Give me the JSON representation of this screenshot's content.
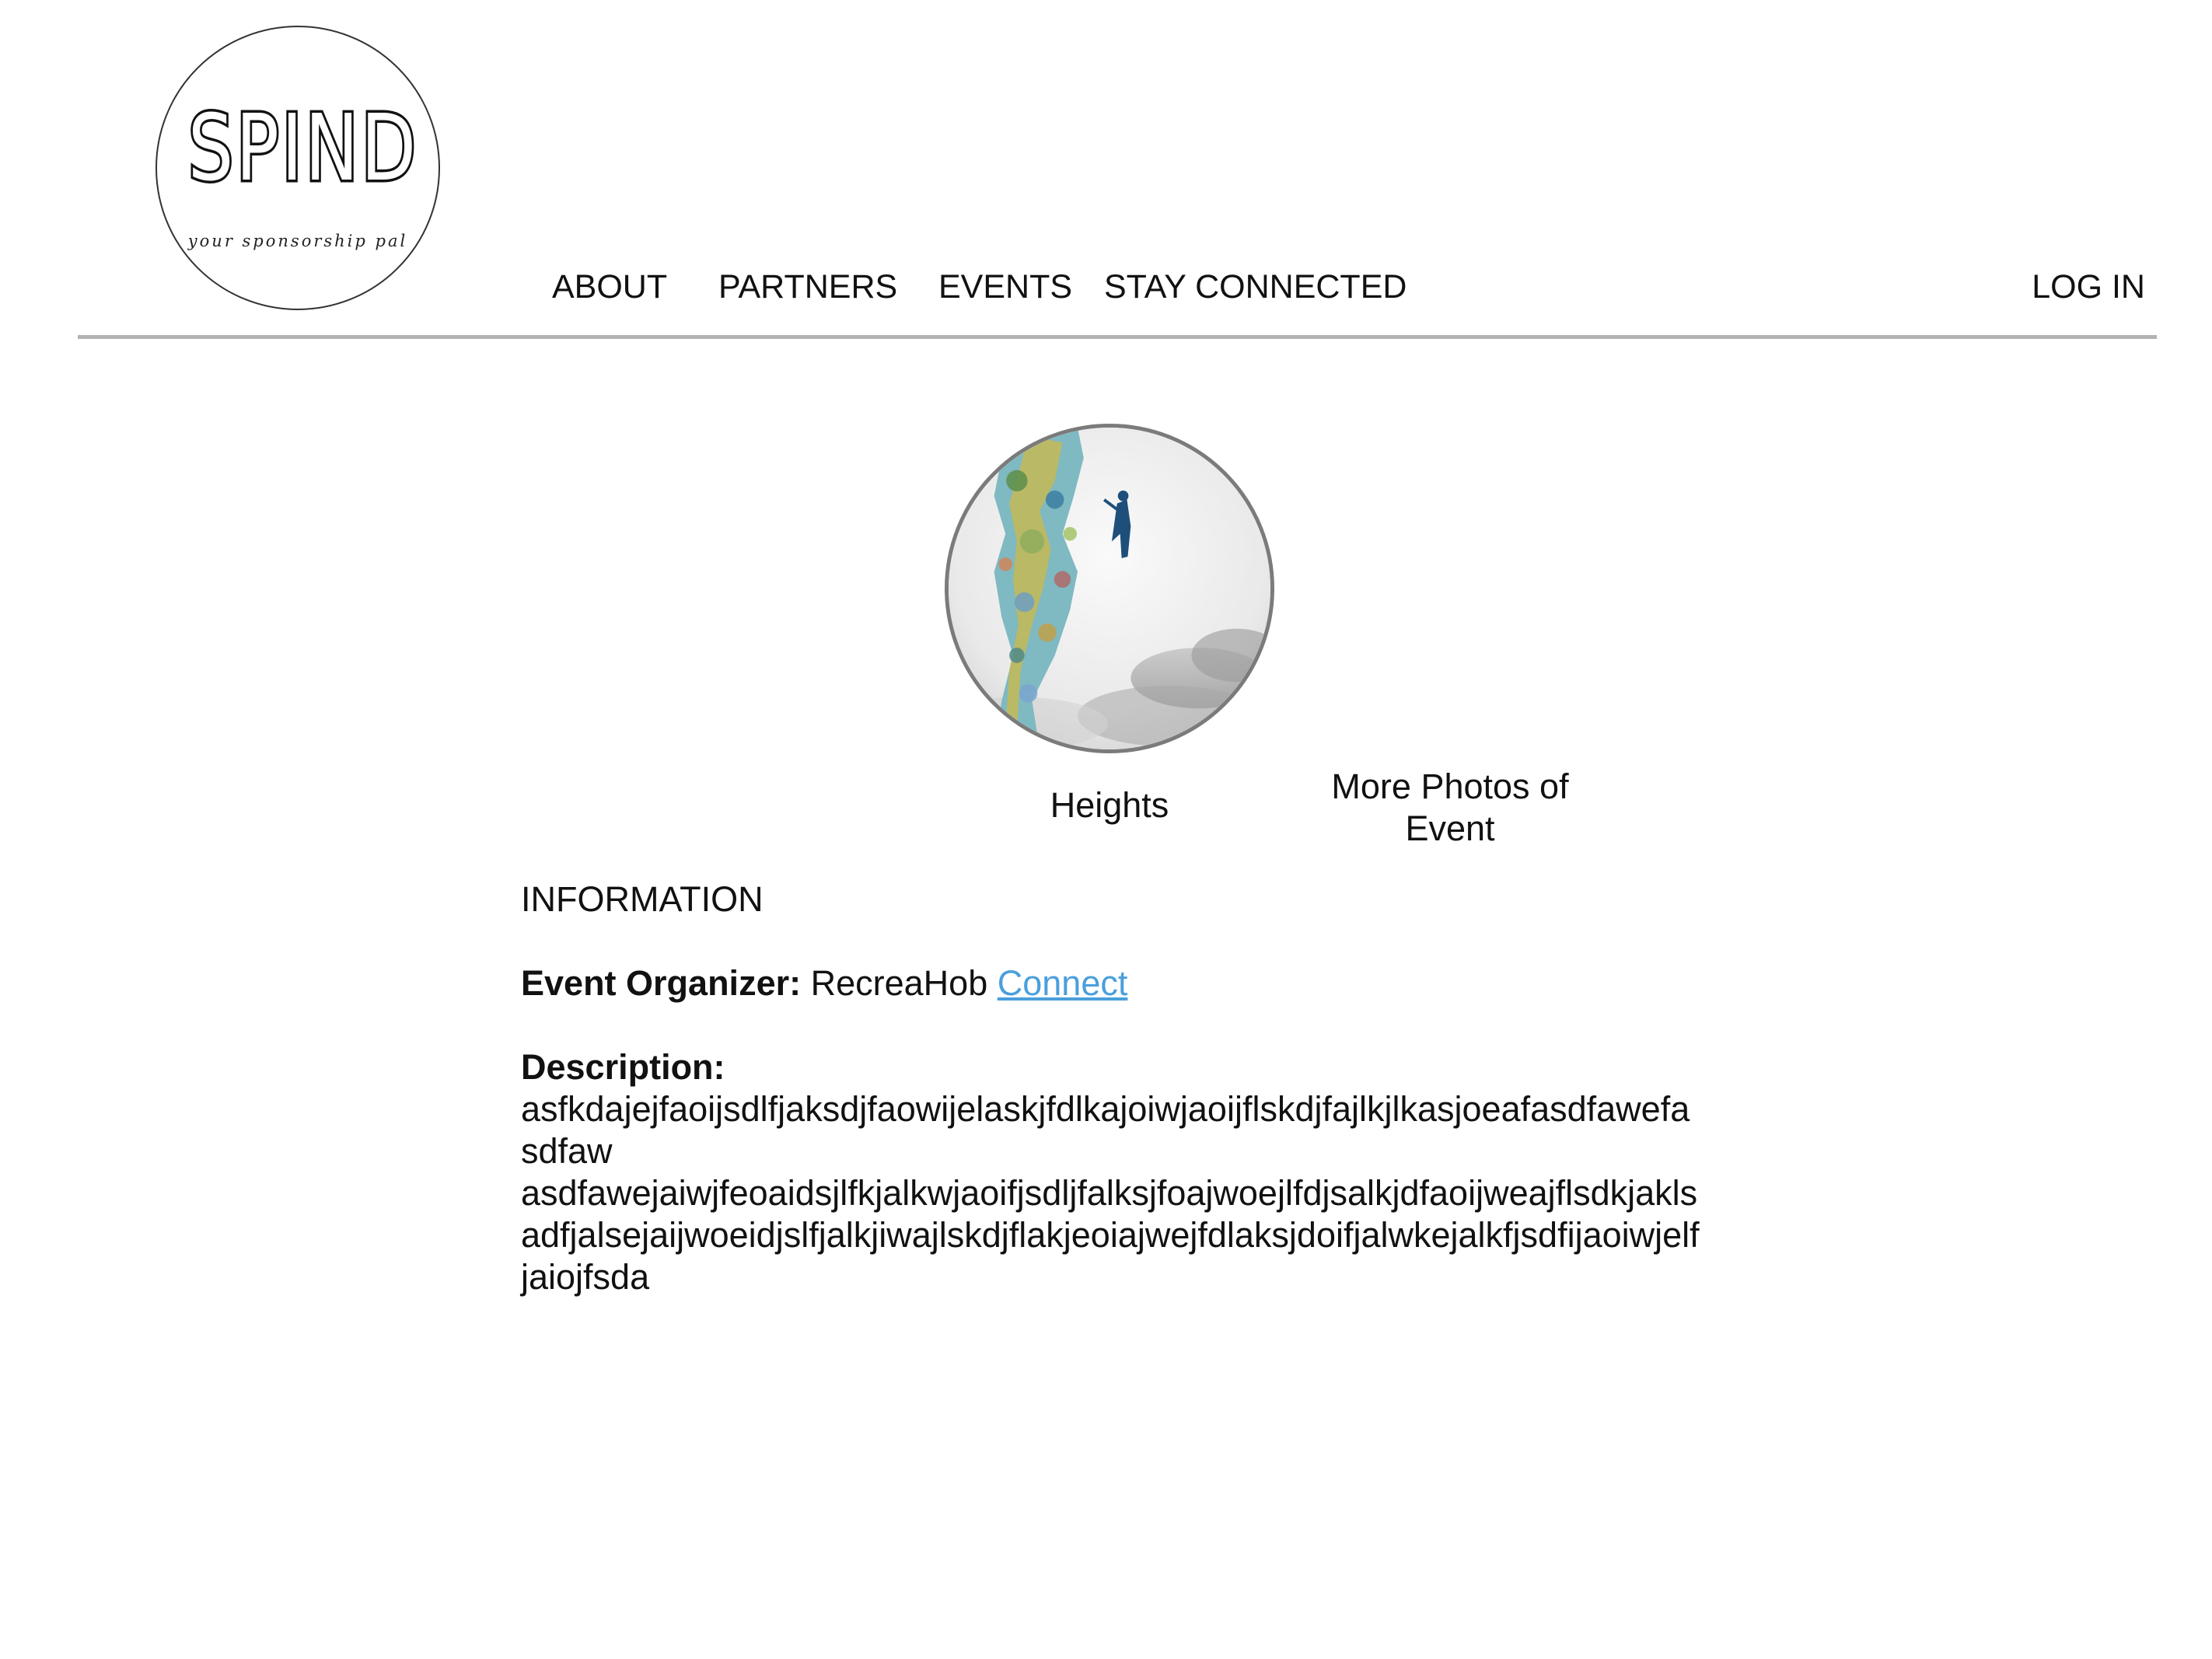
{
  "logo": {
    "wordmark": "SPIND",
    "tagline": "your sponsorship pal"
  },
  "nav": {
    "items": [
      {
        "label": "ABOUT"
      },
      {
        "label": "PARTNERS"
      },
      {
        "label": "EVENTS"
      },
      {
        "label": "STAY CONNECTED"
      }
    ],
    "login_label": "LOG IN"
  },
  "event": {
    "name": "Heights",
    "more_photos_label": "More Photos of Event"
  },
  "information": {
    "heading": "INFORMATION",
    "organizer_label": "Event Organizer:",
    "organizer_name": "RecreaHob",
    "connect_label": "Connect",
    "description_label": "Description:",
    "description_lines": [
      "asfkdajejfaoijsdlfjaksdjfaowijelaskjfdlkajoiwjaoijflskdjfajlkjlkasjoeafasdfawefasdfaw",
      "asdfawejaiwjfeoaidsjlfkjalkwjaoifjsdljfalksjfoajwoejlfdjsalkjdfaoijweajflsdkjakls",
      "adfjalsejaijwoeidjslfjalkjiwajlskdjflakjeoiajwejfdlaksjdoifjalwkejalkfjsdfijaoiwjelfjaiojfsda"
    ]
  },
  "colors": {
    "link": "#4a9fdc",
    "divider": "#b3b3b3",
    "photo_border": "#7b7b7b"
  }
}
